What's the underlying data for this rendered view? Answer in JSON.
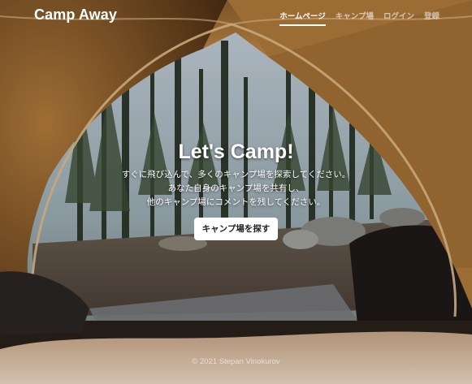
{
  "brand": "Camp Away",
  "nav": {
    "items": [
      {
        "label": "ホームページ",
        "active": true
      },
      {
        "label": "キャンプ場",
        "active": false
      },
      {
        "label": "ログイン",
        "active": false
      },
      {
        "label": "登録",
        "active": false
      }
    ]
  },
  "hero": {
    "title": "Let's Camp!",
    "lines": [
      "すぐに飛び込んで、多くのキャンプ場を探索してください。",
      "あなた自身のキャンプ場を共有し、",
      "他のキャンプ場にコメントを残してください。"
    ],
    "cta_label": "キャンプ場を探す"
  },
  "footer": {
    "copyright": "© 2021 Stepan Vinokurov"
  },
  "background": {
    "description_icon": "tent-forest-photo"
  }
}
